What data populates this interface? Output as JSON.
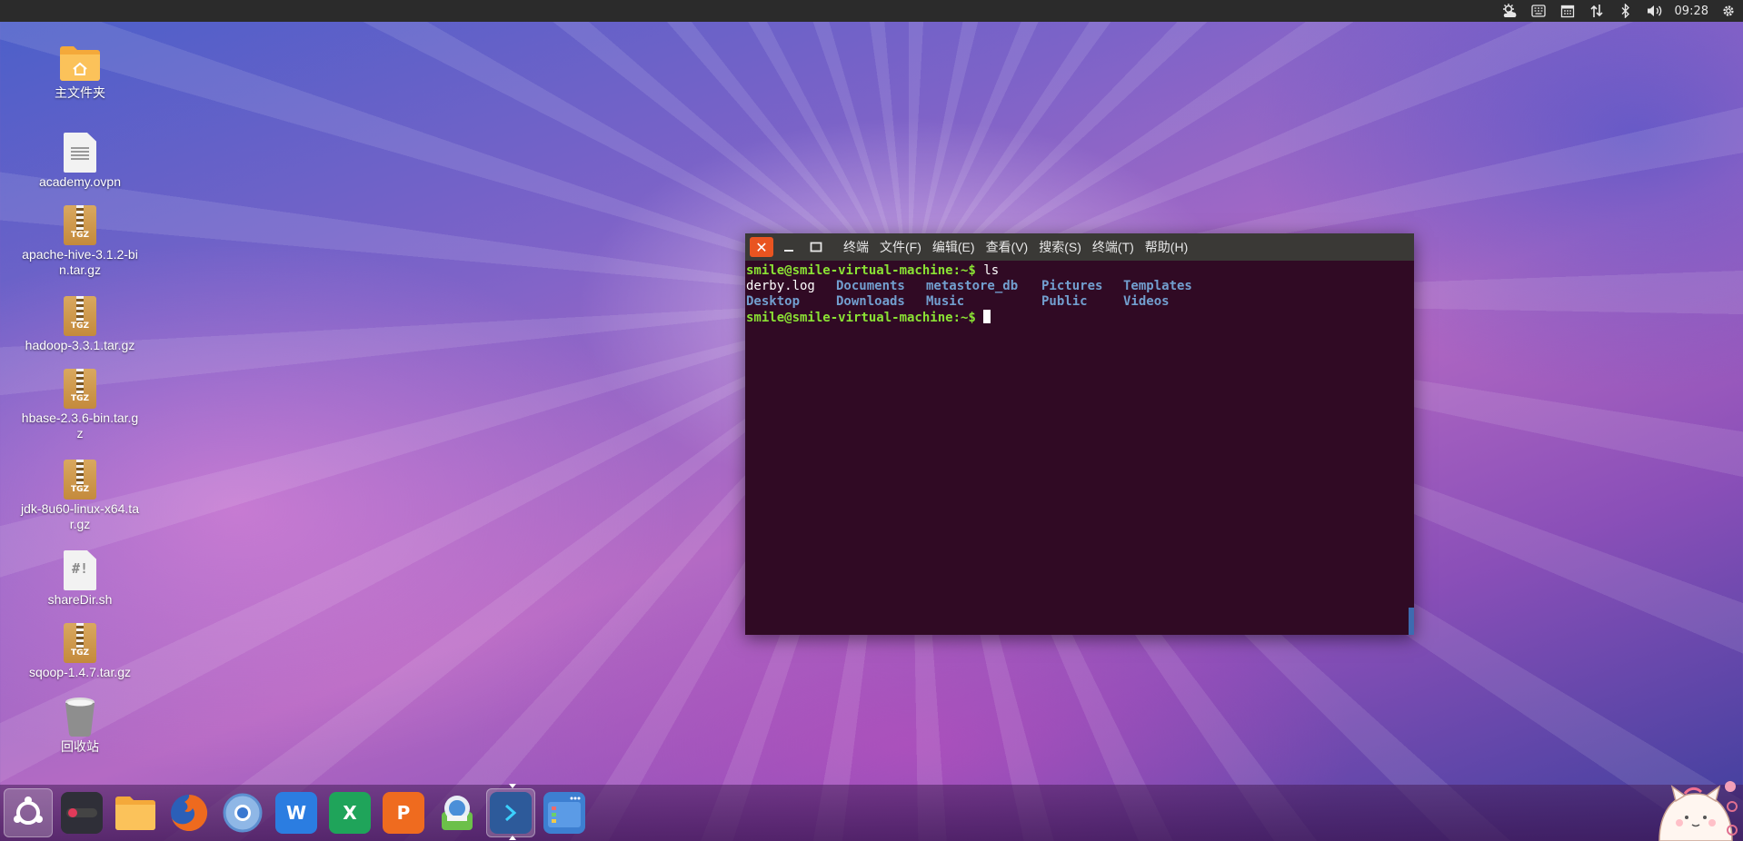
{
  "top_panel": {
    "time": "09:28",
    "tray_icons": [
      "weather-icon",
      "keyboard-icon",
      "calendar-icon",
      "network-icon",
      "bluetooth-icon",
      "volume-icon",
      "settings-gear-icon"
    ]
  },
  "desktop_icons": [
    {
      "label": "主文件夹",
      "type": "folder"
    },
    {
      "label": "academy.ovpn",
      "type": "document"
    },
    {
      "label": "apache-hive-3.1.2-bin.tar.gz",
      "type": "tgz"
    },
    {
      "label": "hadoop-3.3.1.tar.gz",
      "type": "tgz"
    },
    {
      "label": "hbase-2.3.6-bin.tar.gz",
      "type": "tgz"
    },
    {
      "label": "jdk-8u60-linux-x64.tar.gz",
      "type": "tgz"
    },
    {
      "label": "shareDir.sh",
      "type": "script"
    },
    {
      "label": "sqoop-1.4.7.tar.gz",
      "type": "tgz"
    },
    {
      "label": "回收站",
      "type": "trash"
    }
  ],
  "file_badges": {
    "tgz": "TGZ",
    "script": "#!"
  },
  "terminal": {
    "menu": [
      "终端",
      "文件(F)",
      "编辑(E)",
      "查看(V)",
      "搜索(S)",
      "终端(T)",
      "帮助(H)"
    ],
    "prompt": "smile@smile-virtual-machine:~$",
    "command": " ls",
    "ls_row1": [
      "derby.log",
      "Documents",
      "metastore_db",
      "Pictures",
      "Templates"
    ],
    "ls_row2": [
      "Desktop",
      "Downloads",
      "Music",
      "Public",
      "Videos"
    ]
  },
  "dock": {
    "items": [
      {
        "name": "ubuntu-kylin-start",
        "active": true
      },
      {
        "name": "terminal-toggle-app",
        "active": false
      },
      {
        "name": "file-manager",
        "active": false
      },
      {
        "name": "firefox",
        "active": false
      },
      {
        "name": "browser",
        "active": false
      },
      {
        "name": "wps-writer",
        "label": "W",
        "active": false
      },
      {
        "name": "wps-spreadsheet",
        "label": "X",
        "active": false
      },
      {
        "name": "wps-presentation",
        "label": "P",
        "active": false
      },
      {
        "name": "software-center",
        "active": false
      },
      {
        "name": "terminal",
        "active": true
      },
      {
        "name": "workspace-switcher",
        "active": false
      }
    ]
  },
  "colors": {
    "panel": "#2b2b2b",
    "terminal_bg": "#300a24",
    "prompt_green": "#8ae234",
    "dir_blue": "#729fcf",
    "close_orange": "#e95420"
  }
}
